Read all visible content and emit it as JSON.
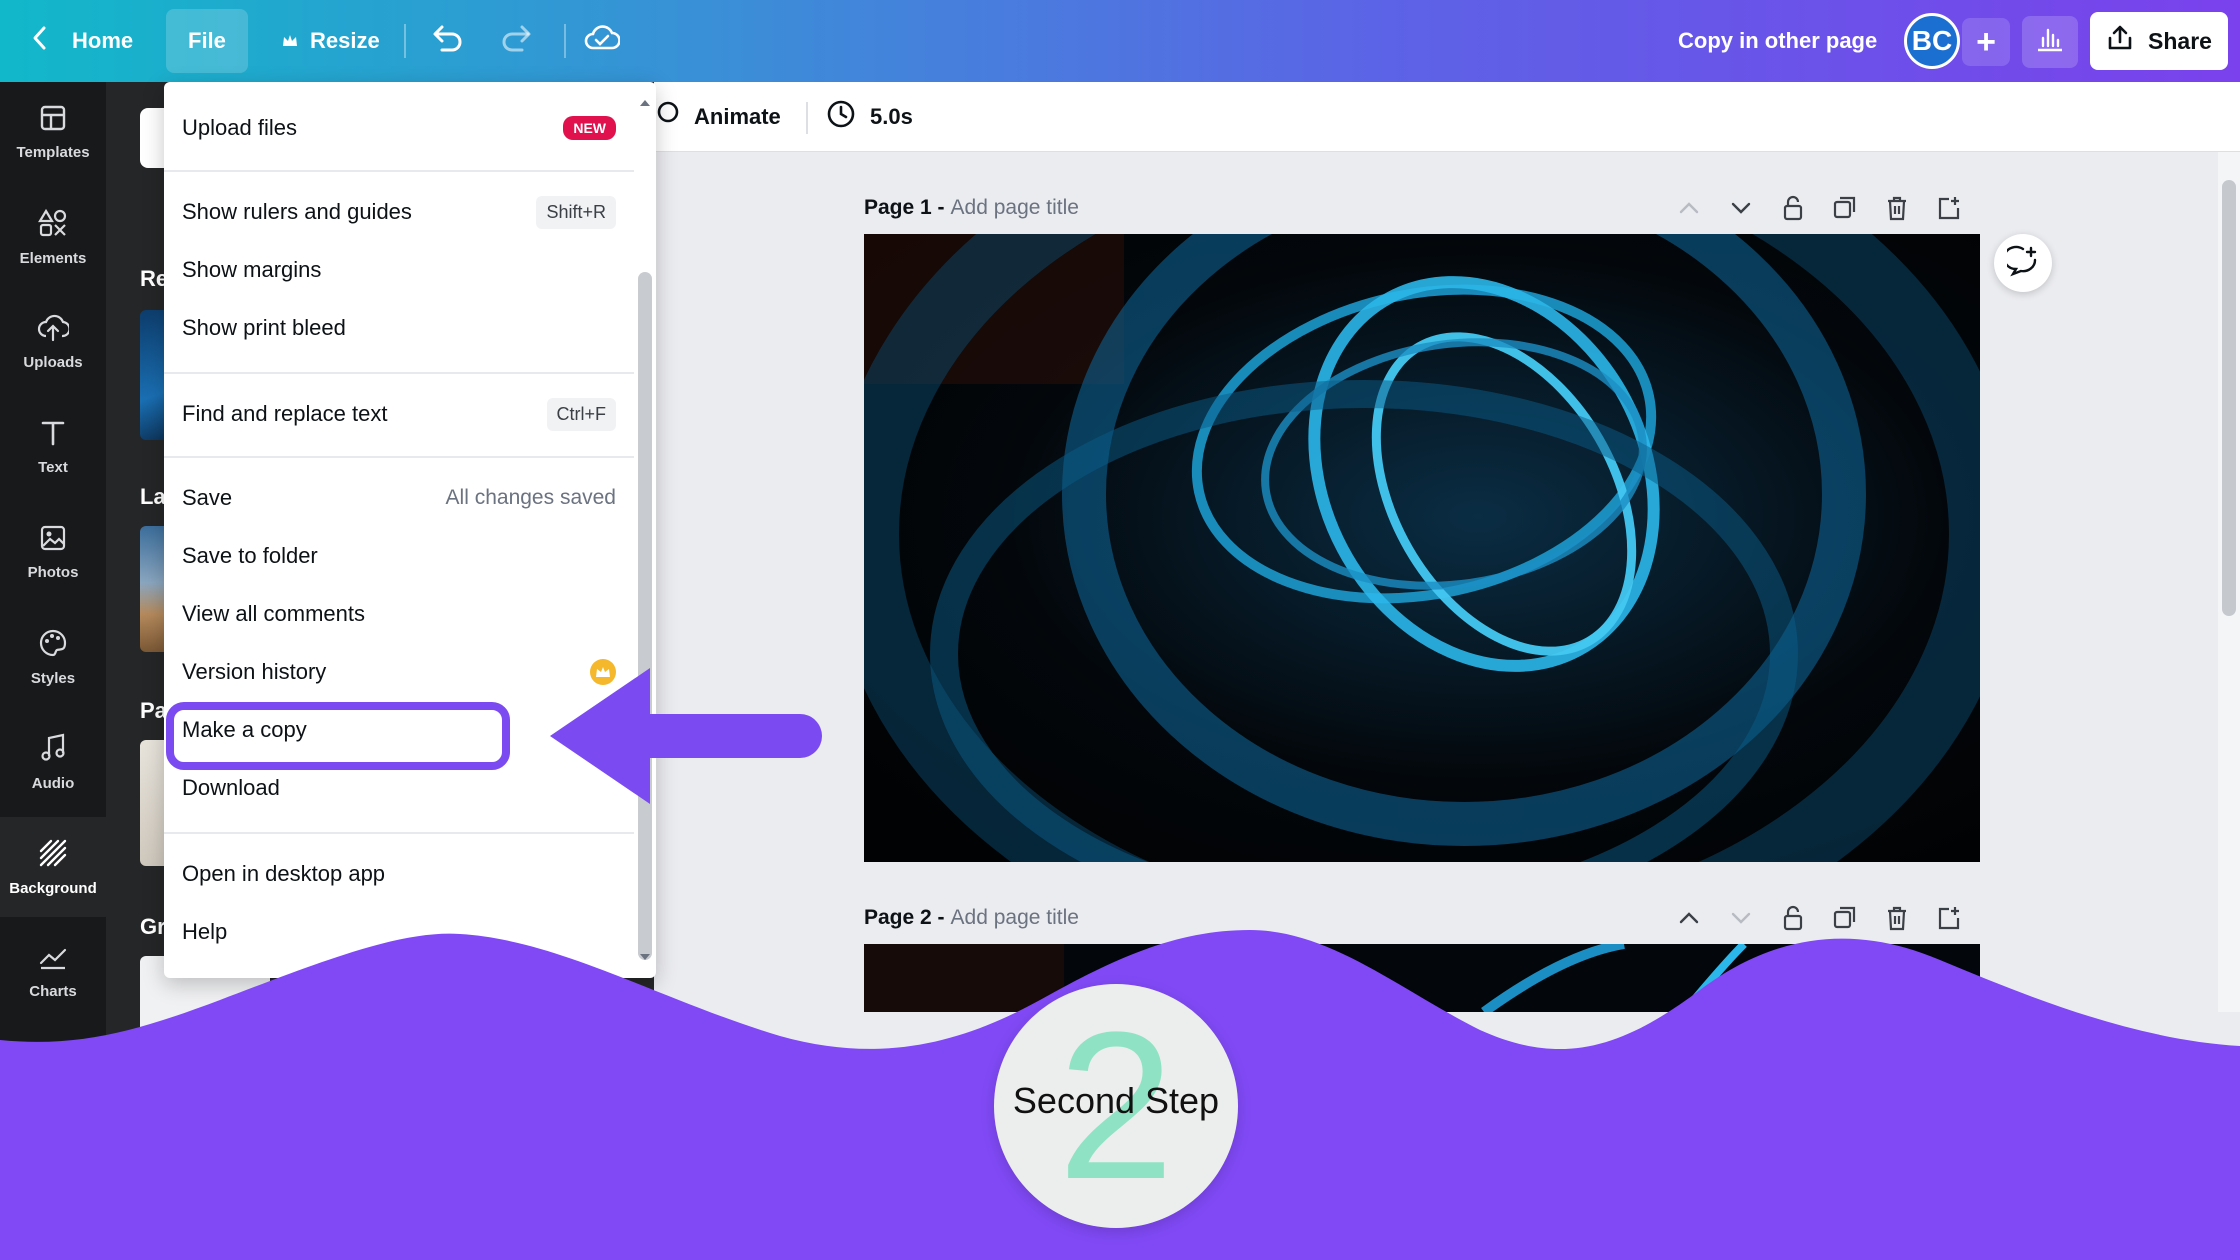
{
  "topbar": {
    "home_label": "Home",
    "file_label": "File",
    "resize_label": "Resize",
    "copy_label": "Copy in other page",
    "avatar_initials": "BC",
    "share_label": "Share"
  },
  "rail": {
    "items": [
      {
        "label": "Templates",
        "icon": "templates-icon"
      },
      {
        "label": "Elements",
        "icon": "elements-icon"
      },
      {
        "label": "Uploads",
        "icon": "uploads-icon"
      },
      {
        "label": "Text",
        "icon": "text-icon"
      },
      {
        "label": "Photos",
        "icon": "photos-icon"
      },
      {
        "label": "Styles",
        "icon": "styles-icon"
      },
      {
        "label": "Audio",
        "icon": "audio-icon"
      },
      {
        "label": "Background",
        "icon": "background-icon"
      },
      {
        "label": "Charts",
        "icon": "charts-icon"
      }
    ],
    "active": "Background"
  },
  "sidepanel": {
    "labels": [
      "Re",
      "La",
      "Pa",
      "Gr"
    ]
  },
  "editor": {
    "animate_label": "Animate",
    "duration": "5.0s"
  },
  "pages": [
    {
      "number": "Page 1 -",
      "title_placeholder": "Add page title"
    },
    {
      "number": "Page 2 -",
      "title_placeholder": "Add page title"
    }
  ],
  "menu": {
    "upload_files": "Upload files",
    "new_badge": "NEW",
    "show_rulers": "Show rulers and guides",
    "show_rulers_shortcut": "Shift+R",
    "show_margins": "Show margins",
    "show_print_bleed": "Show print bleed",
    "find_replace": "Find and replace text",
    "find_replace_shortcut": "Ctrl+F",
    "save": "Save",
    "save_status": "All changes saved",
    "save_to_folder": "Save to folder",
    "view_comments": "View all comments",
    "version_history": "Version history",
    "make_copy": "Make a copy",
    "download": "Download",
    "open_desktop": "Open in desktop app",
    "help": "Help"
  },
  "overlay": {
    "step_number": "2",
    "step_text": "Second Step",
    "accent_color": "#7b4af0",
    "step_number_color": "#8fe3c4"
  }
}
